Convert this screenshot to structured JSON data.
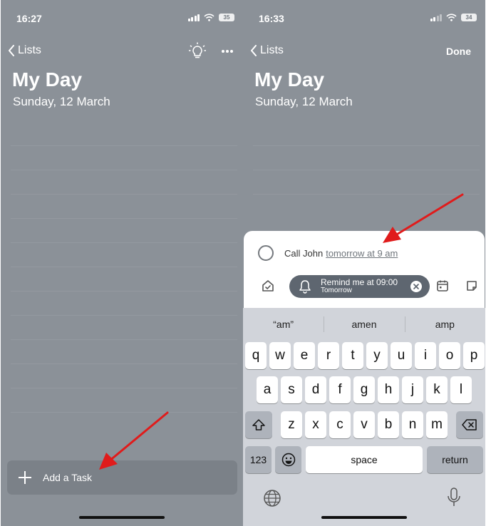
{
  "left": {
    "status": {
      "time": "16:27",
      "battery": "35"
    },
    "nav": {
      "back_label": "Lists"
    },
    "title": "My Day",
    "subtitle": "Sunday, 12 March",
    "add_task_label": "Add a Task"
  },
  "right": {
    "status": {
      "time": "16:33",
      "battery": "34"
    },
    "nav": {
      "back_label": "Lists",
      "done_label": "Done"
    },
    "title": "My Day",
    "subtitle": "Sunday, 12 March",
    "task": {
      "text": "Call John",
      "date_text": "tomorrow at 9 am"
    },
    "reminder": {
      "title": "Remind me at 09:00",
      "subtitle": "Tomorrow"
    },
    "keyboard": {
      "suggestions": [
        "“am”",
        "amen",
        "amp"
      ],
      "row1": [
        "q",
        "w",
        "e",
        "r",
        "t",
        "y",
        "u",
        "i",
        "o",
        "p"
      ],
      "row2": [
        "a",
        "s",
        "d",
        "f",
        "g",
        "h",
        "j",
        "k",
        "l"
      ],
      "row3": [
        "z",
        "x",
        "c",
        "v",
        "b",
        "n",
        "m"
      ],
      "numbers_label": "123",
      "space_label": "space",
      "return_label": "return"
    }
  },
  "colors": {
    "background": "#8b9198",
    "arrow": "#e01b1b",
    "chip": "#5e6670",
    "keyboard": "#d1d4da"
  },
  "icons": {
    "left_nav": [
      "chevron-left-icon",
      "lightbulb-icon",
      "more-icon"
    ],
    "add_task": "plus-icon",
    "sheet": [
      "circle-checkbox-icon",
      "my-day-icon",
      "bell-icon",
      "clear-icon",
      "calendar-icon",
      "note-icon"
    ],
    "keyboard": [
      "shift-icon",
      "backspace-icon",
      "emoji-icon",
      "globe-icon",
      "microphone-icon"
    ]
  }
}
